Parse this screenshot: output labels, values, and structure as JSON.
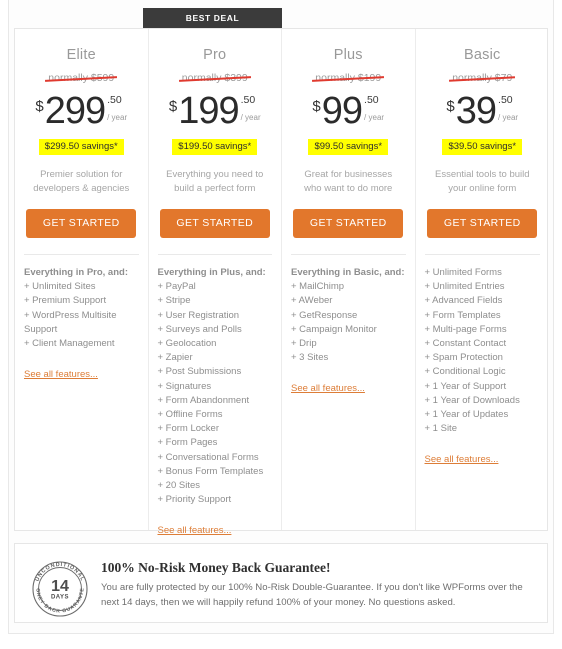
{
  "ribbon": {
    "label": "BEST DEAL"
  },
  "currency_symbol": "$",
  "plans": [
    {
      "name": "Elite",
      "normally": "normally $599",
      "amount": "299",
      "cents": ".50",
      "per": "/ year",
      "savings": "$299.50 savings*",
      "description": "Premier solution for developers & agencies",
      "cta": "GET STARTED",
      "features_title": "Everything in Pro, and:",
      "features": [
        "+ Unlimited Sites",
        "+ Premium Support",
        "+ WordPress Multisite Support",
        "+ Client Management"
      ],
      "see_all": "See all features...",
      "featured": false
    },
    {
      "name": "Pro",
      "normally": "normally $399",
      "amount": "199",
      "cents": ".50",
      "per": "/ year",
      "savings": "$199.50 savings*",
      "description": "Everything you need to build a perfect form",
      "cta": "GET STARTED",
      "features_title": "Everything in Plus, and:",
      "features": [
        "+ PayPal",
        "+ Stripe",
        "+ User Registration",
        "+ Surveys and Polls",
        "+ Geolocation",
        "+ Zapier",
        "+ Post Submissions",
        "+ Signatures",
        "+ Form Abandonment",
        "+ Offline Forms",
        "+ Form Locker",
        "+ Form Pages",
        "+ Conversational Forms",
        "+ Bonus Form Templates",
        "+ 20 Sites",
        "+ Priority Support"
      ],
      "see_all": "See all features...",
      "featured": true
    },
    {
      "name": "Plus",
      "normally": "normally $199",
      "amount": "99",
      "cents": ".50",
      "per": "/ year",
      "savings": "$99.50 savings*",
      "description": "Great for businesses who want to do more",
      "cta": "GET STARTED",
      "features_title": "Everything in Basic, and:",
      "features": [
        "+ MailChimp",
        "+ AWeber",
        "+ GetResponse",
        "+ Campaign Monitor",
        "+ Drip",
        "+ 3 Sites"
      ],
      "see_all": "See all features...",
      "featured": false
    },
    {
      "name": "Basic",
      "normally": "normally $79",
      "amount": "39",
      "cents": ".50",
      "per": "/ year",
      "savings": "$39.50 savings*",
      "description": "Essential tools to build your online form",
      "cta": "GET STARTED",
      "features_title": "",
      "features": [
        "+ Unlimited Forms",
        "+ Unlimited Entries",
        "+ Advanced Fields",
        "+ Form Templates",
        "+ Multi-page Forms",
        "+ Constant Contact",
        "+ Spam Protection",
        "+ Conditional Logic",
        "+ 1 Year of Support",
        "+ 1 Year of Downloads",
        "+ 1 Year of Updates",
        "+ 1 Site"
      ],
      "see_all": "See all features...",
      "featured": false
    }
  ],
  "guarantee": {
    "badge_top_text": "UNCONDITIONAL",
    "badge_bottom_text": "MONEY BACK GUARANTEE",
    "badge_number": "14",
    "badge_unit": "DAYS",
    "title": "100% No-Risk Money Back Guarantee!",
    "body": "You are fully protected by our 100% No-Risk Double-Guarantee. If you don't like WPForms over the next 14 days, then we will happily refund 100% of your money. No questions asked."
  },
  "colors": {
    "cta": "#e2772c",
    "ribbon": "#3b3b3b",
    "savings_highlight": "#ffff00",
    "strike": "#e03a2f",
    "link": "#dd7d37"
  }
}
